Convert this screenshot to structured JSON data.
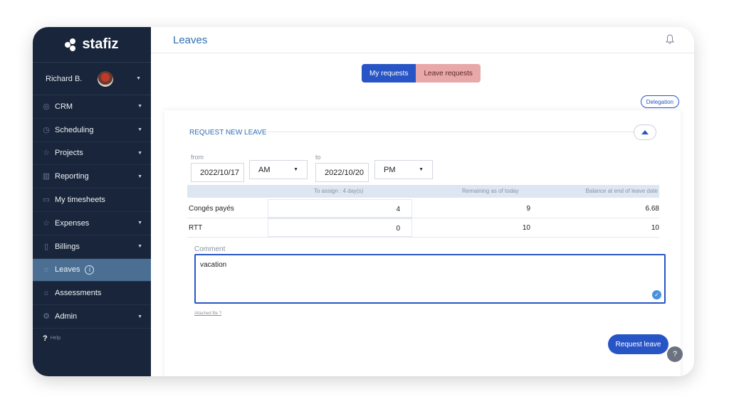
{
  "sidebar": {
    "brand": "stafiz",
    "user_name": "Richard B.",
    "items": [
      {
        "label": "CRM",
        "icon": "user-circle-icon"
      },
      {
        "label": "Scheduling",
        "icon": "clock-icon"
      },
      {
        "label": "Projects",
        "icon": "star-icon"
      },
      {
        "label": "Reporting",
        "icon": "chart-icon"
      },
      {
        "label": "My timesheets",
        "icon": "calendar-icon"
      },
      {
        "label": "Expenses",
        "icon": "star-icon"
      },
      {
        "label": "Billings",
        "icon": "document-icon"
      },
      {
        "label": "Leaves",
        "icon": "sun-icon"
      },
      {
        "label": "Assessments",
        "icon": "sun-icon"
      },
      {
        "label": "Admin",
        "icon": "gear-icon"
      }
    ],
    "help_label": "Help"
  },
  "header": {
    "title": "Leaves"
  },
  "tabs": {
    "my_requests": "My requests",
    "leave_requests": "Leave requests"
  },
  "delegation_label": "Delegation",
  "request": {
    "section_title": "REQUEST NEW LEAVE",
    "from_label": "from",
    "to_label": "to",
    "from_date": "2022/10/17",
    "from_period": "AM",
    "to_date": "2022/10/20",
    "to_period": "PM",
    "table": {
      "headers": {
        "assign": "To assign : 4 day(s)",
        "remaining": "Remaining as of today",
        "balance": "Balance at end of leave date"
      },
      "rows": [
        {
          "type": "Congés payés",
          "assign": "4",
          "remaining": "9",
          "balance": "6.68"
        },
        {
          "type": "RTT",
          "assign": "0",
          "remaining": "10",
          "balance": "10"
        }
      ]
    },
    "comment_label": "Comment",
    "comment_value": "vacation",
    "attached_label": "Attached file ?",
    "submit_label": "Request leave"
  },
  "colors": {
    "sidebar_bg": "#18253a",
    "active_item": "#4a6f93",
    "primary": "#2855c6",
    "leave_requests_tab": "#e8a7a9",
    "title_blue": "#2f6fb3"
  }
}
